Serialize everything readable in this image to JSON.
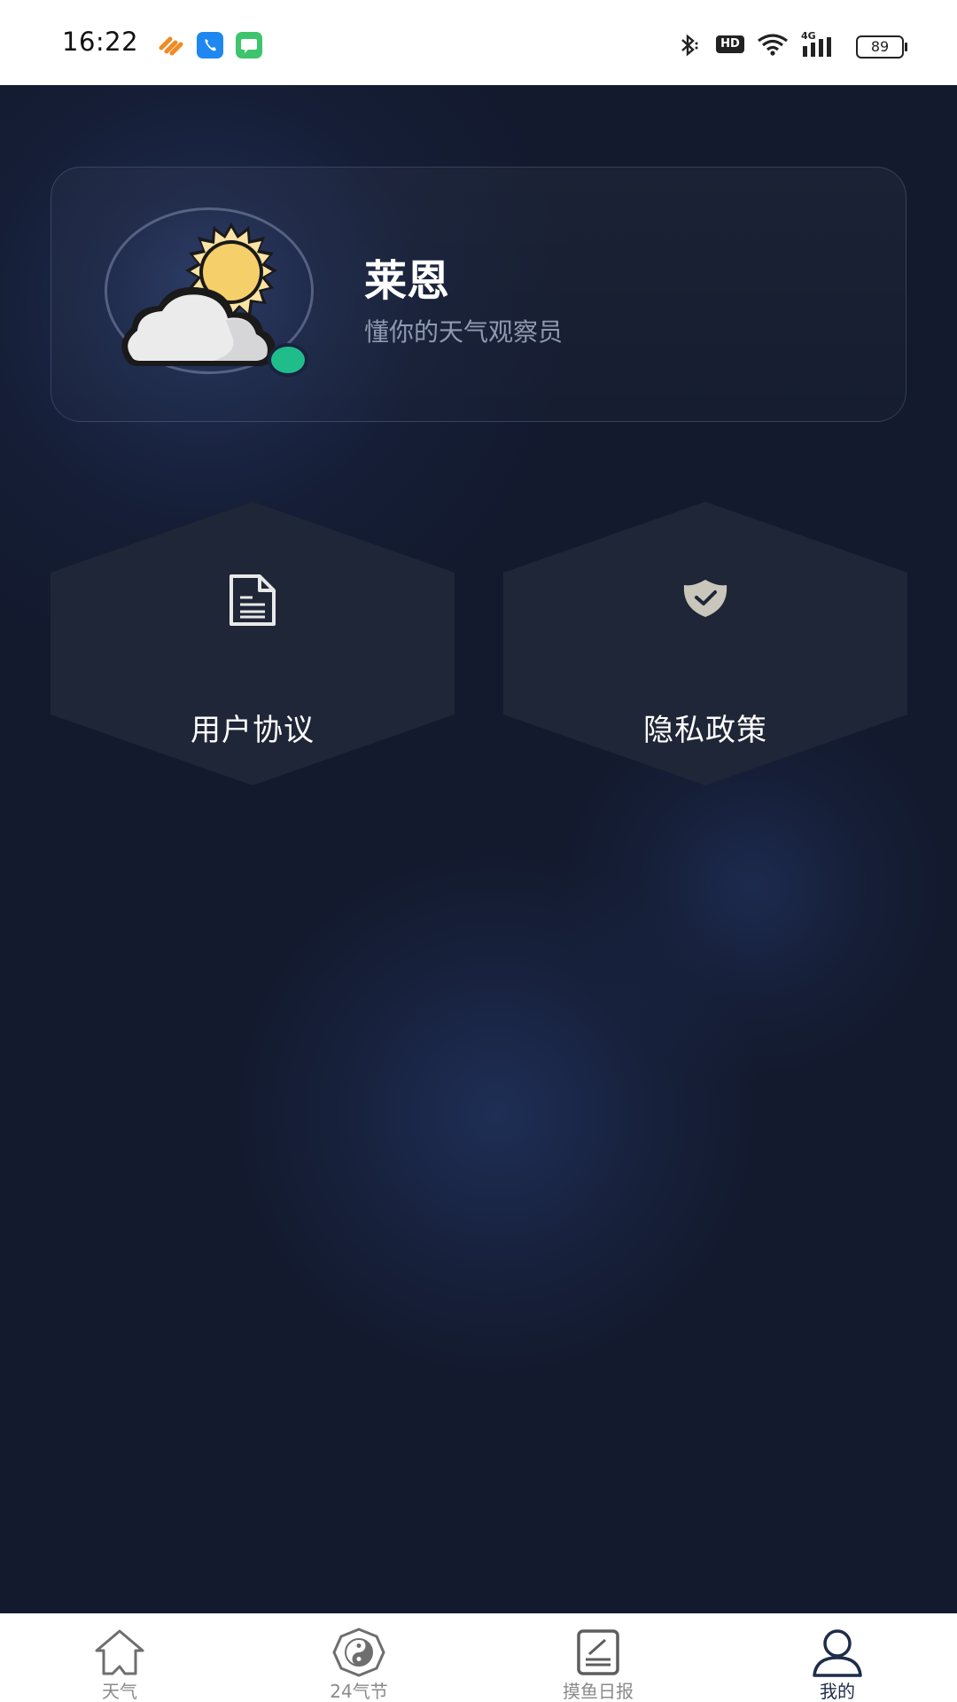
{
  "status_bar": {
    "time": "16:22",
    "app_icons": [
      "link-app-icon",
      "phone-app-icon",
      "messages-app-icon"
    ],
    "system_icons": [
      "bluetooth-icon",
      "hd-icon",
      "wifi-icon",
      "signal-4g-icon",
      "battery-icon"
    ],
    "hd_label": "HD",
    "network_label": "4G",
    "battery_level": "89"
  },
  "profile": {
    "name": "莱恩",
    "subtitle": "懂你的天气观察员",
    "avatar_icon": "sun-cloud-icon",
    "online_color": "#1fbd8a"
  },
  "tiles": [
    {
      "label": "用户协议",
      "icon": "document-icon"
    },
    {
      "label": "隐私政策",
      "icon": "shield-check-icon"
    }
  ],
  "bottom_nav": {
    "items": [
      {
        "label": "天气",
        "icon": "home-icon",
        "active": false
      },
      {
        "label": "24气节",
        "icon": "yin-yang-icon",
        "active": false
      },
      {
        "label": "摸鱼日报",
        "icon": "notepad-icon",
        "active": false
      },
      {
        "label": "我的",
        "icon": "person-icon",
        "active": true
      }
    ]
  },
  "colors": {
    "background": "#131a2e",
    "tile": "#1f2637",
    "accent_active": "#1e2d4a"
  }
}
